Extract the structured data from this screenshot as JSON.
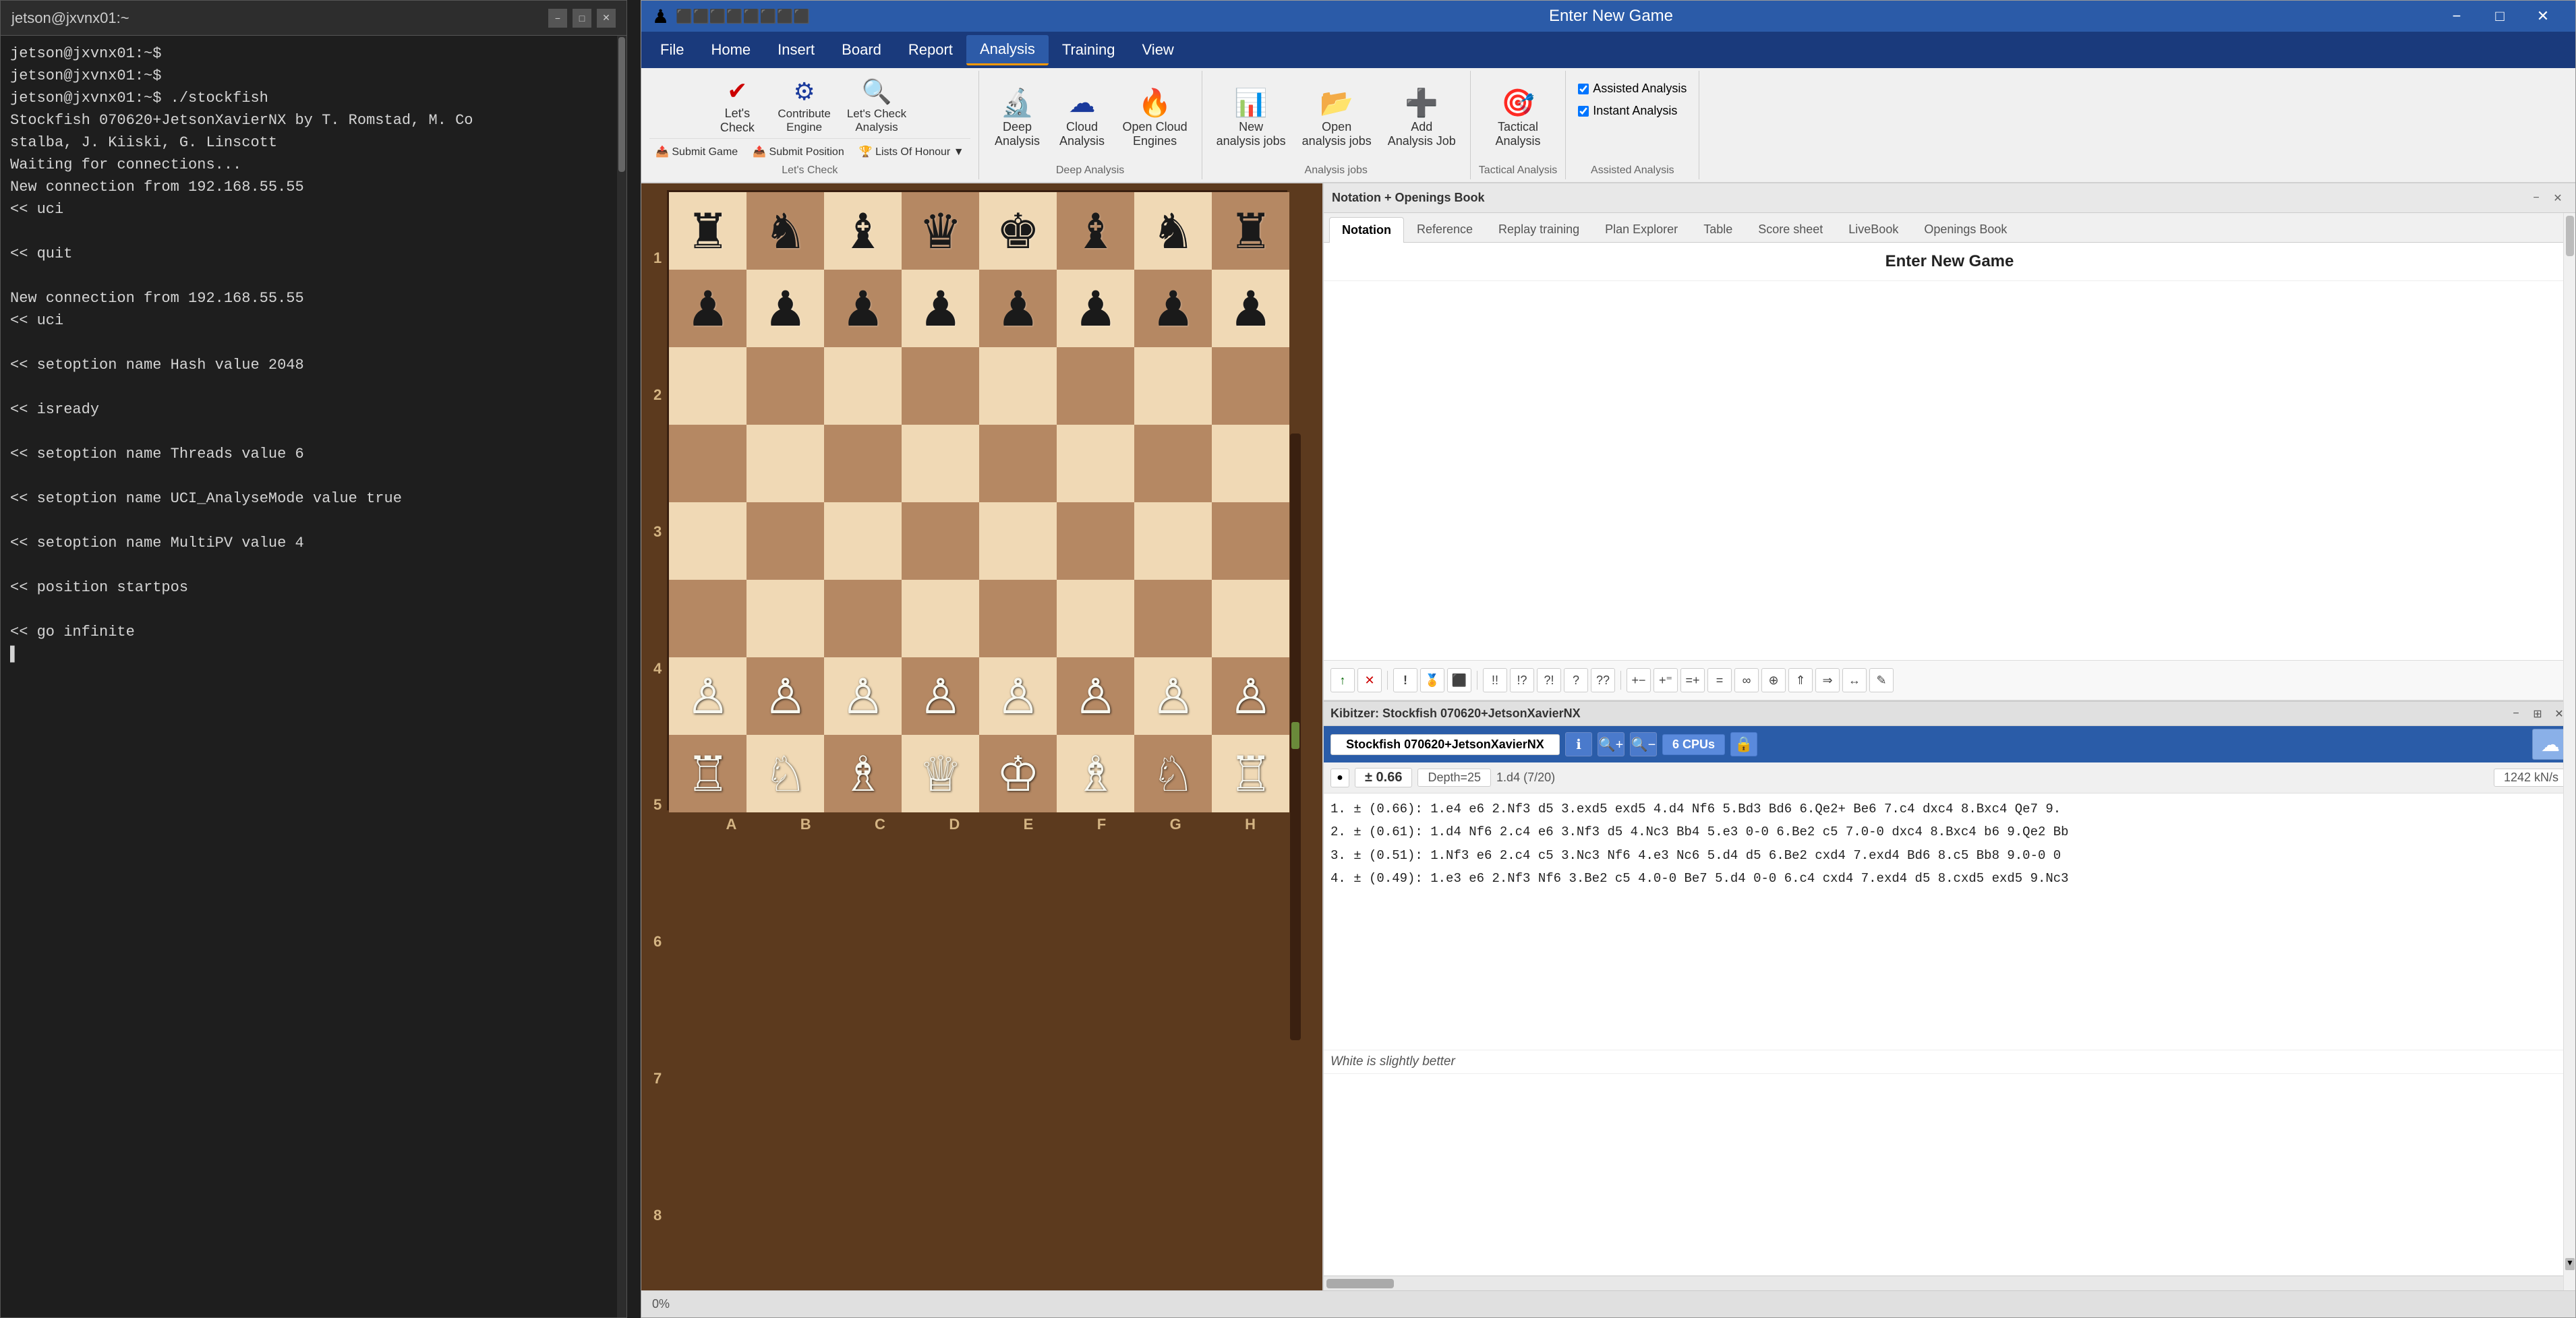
{
  "terminal": {
    "title": "jetson@jxvnx01:~",
    "lines": [
      "jetson@jxvnx01:~$",
      "jetson@jxvnx01:~$",
      "jetson@jxvnx01:~$  ./stockfish",
      "Stockfish 070620+JetsonXavierNX by T. Romstad, M. Co",
      "stalba, J. Kiiski, G. Linscott",
      "Waiting for connections...",
      "New connection from 192.168.55.55",
      "<< uci",
      "",
      "<< quit",
      "",
      "New connection from 192.168.55.55",
      "<< uci",
      "",
      "<< setoption name Hash value 2048",
      "",
      "<< isready",
      "",
      "<< setoption name Threads value 6",
      "",
      "<< setoption name UCI_AnalyseMode value true",
      "",
      "<< setoption name MultiPV value 4",
      "",
      "<< position startpos",
      "",
      "<< go infinite",
      ""
    ],
    "controls": [
      "−",
      "□",
      "✕"
    ]
  },
  "chess_app": {
    "title": "Enter New Game",
    "window_controls": [
      "−",
      "□",
      "✕"
    ],
    "titlebar_icons": [
      "⚙",
      "?"
    ],
    "menu": {
      "items": [
        "File",
        "Home",
        "Insert",
        "Board",
        "Report",
        "Analysis",
        "Training",
        "View"
      ],
      "active": "Analysis"
    },
    "toolbar": {
      "groups": [
        {
          "name": "lets-check",
          "label": "Let's Check",
          "buttons": [
            {
              "label": "Let's\nCheck",
              "icon": "✔",
              "icon_color": "red"
            },
            {
              "label": "Contribute\nEngine",
              "icon": "⚙",
              "icon_color": "blue"
            },
            {
              "label": "Let's Check\nAnalysis",
              "icon": "🔍",
              "icon_color": "blue"
            }
          ],
          "sub_buttons": [
            {
              "label": "Submit Game",
              "icon": "📤"
            },
            {
              "label": "Submit Position",
              "icon": "📤"
            },
            {
              "label": "Lists Of Honour ▼",
              "icon": "🏆"
            }
          ]
        },
        {
          "name": "deep-analysis",
          "label": "Deep Analysis",
          "buttons": [
            {
              "label": "Deep\nAnalysis",
              "icon": "🔬",
              "icon_color": "blue"
            },
            {
              "label": "Cloud\nAnalysis",
              "icon": "☁",
              "icon_color": "blue"
            },
            {
              "label": "Open Cloud\nEngines",
              "icon": "🔥",
              "icon_color": "red"
            }
          ]
        },
        {
          "name": "analysis-jobs",
          "label": "Analysis jobs",
          "buttons": [
            {
              "label": "New\nanalysis jobs",
              "icon": "📊",
              "icon_color": "red"
            },
            {
              "label": "Open\nanalysis jobs",
              "icon": "📂",
              "icon_color": "blue"
            },
            {
              "label": "Add\nAnalysis Job",
              "icon": "➕",
              "icon_color": "blue"
            }
          ]
        },
        {
          "name": "tactical-analysis",
          "label": "Tactical Analysis",
          "buttons": [
            {
              "label": "Tactical\nAnalysis",
              "icon": "🎯",
              "icon_color": "orange"
            }
          ]
        },
        {
          "name": "assisted-analysis",
          "label": "Assisted Analysis",
          "checkboxes": [
            {
              "label": "Assisted Analysis",
              "checked": true
            },
            {
              "label": "Instant Analysis",
              "checked": true
            }
          ]
        }
      ]
    },
    "right_panel": {
      "title": "Notation + Openings Book",
      "tabs": [
        "Notation",
        "Reference",
        "Replay training",
        "Plan Explorer",
        "Table",
        "Score sheet",
        "LiveBook",
        "Openings Book"
      ],
      "active_tab": "Notation",
      "game_title": "Enter New Game"
    },
    "kibitzer": {
      "title": "Kibitzer: Stockfish 070620+JetsonXavierNX",
      "engine_name": "Stockfish 070620+JetsonXavierNX",
      "eval": "± 0.66",
      "depth": "Depth=25",
      "pv": "1.d4 (7/20)",
      "nps": "1242 kN/s",
      "cpu_count": "6 CPUs",
      "lines": [
        "1. ± (0.66): 1.e4 e6 2.Nf3 d5 3.exd5 exd5 4.d4 Nf6 5.Bd3 Bd6 6.Qe2+ Be6 7.c4 dxc4 8.Bxc4 Qe7 9.",
        "2. ± (0.61): 1.d4 Nf6 2.c4 e6 3.Nf3 d5 4.Nc3 Bb4 5.e3 0-0 6.Be2 c5 7.0-0 dxc4 8.Bxc4 b6 9.Qe2 Bb",
        "3. ± (0.51): 1.Nf3 e6 2.c4 c5 3.Nc3 Nf6 4.e3 Nc6 5.d4 d5 6.Be2 cxd4 7.exd4 Bd6 8.c5 Bb8 9.0-0 0",
        "4. ± (0.49): 1.e3 e6 2.Nf3 Nf6 3.Be2 c5 4.0-0 Be7 5.d4 0-0 6.c4 cxd4 7.exd4 d5 8.cxd5 exd5 9.Nc3"
      ],
      "verdict": "White is slightly better"
    },
    "board": {
      "files": [
        "A",
        "B",
        "C",
        "D",
        "E",
        "F",
        "G",
        "H"
      ],
      "ranks": [
        "1",
        "2",
        "3",
        "4",
        "5",
        "6",
        "7",
        "8"
      ],
      "pieces": {
        "a8": "♜",
        "b8": "♞",
        "c8": "♝",
        "d8": "♛",
        "e8": "♚",
        "f8": "♝",
        "g8": "♞",
        "h8": "♜",
        "a7": "♟",
        "b7": "♟",
        "c7": "♟",
        "d7": "♟",
        "e7": "♟",
        "f7": "♟",
        "g7": "♟",
        "h7": "♟",
        "a2": "♙",
        "b2": "♙",
        "c2": "♙",
        "d2": "♙",
        "e2": "♙",
        "f2": "♙",
        "g2": "♙",
        "h2": "♙",
        "a1": "♖",
        "b1": "♘",
        "c1": "♗",
        "d1": "♕",
        "e1": "♔",
        "f1": "♗",
        "g1": "♘",
        "h1": "♖"
      }
    },
    "annotation_toolbar": {
      "buttons": [
        "↑",
        "✕",
        "!",
        "‼",
        "!!",
        "!?",
        "?!",
        "?",
        "??",
        "+-",
        "+−",
        "=+",
        "=",
        "∞",
        "⊕",
        "⇑",
        "⇒",
        "↔",
        "✎"
      ]
    },
    "status_bar": {
      "zoom": "0%"
    }
  }
}
